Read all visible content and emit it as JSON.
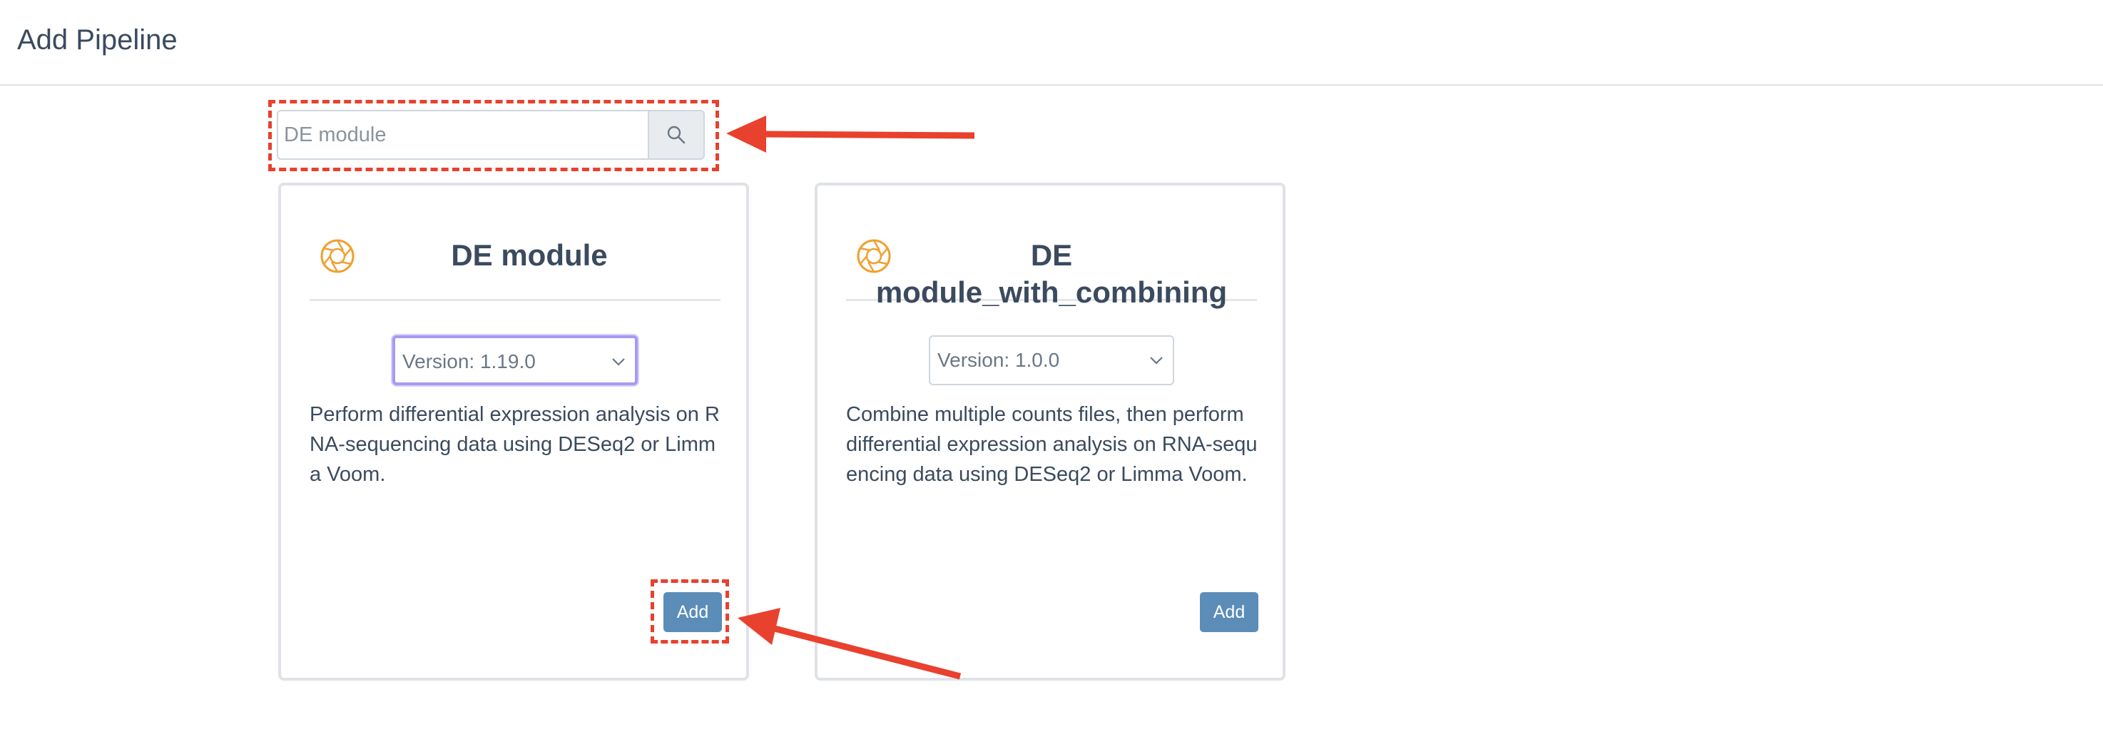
{
  "header": {
    "title": "Add Pipeline"
  },
  "search": {
    "placeholder": "DE module",
    "button_icon": "search-icon"
  },
  "cards": [
    {
      "icon": "aperture-icon",
      "title": "DE module",
      "version": "Version: 1.19.0",
      "description": "Perform differential expression analysis on RNA-sequencing data using DESeq2 or Limma Voom.",
      "add_label": "Add"
    },
    {
      "icon": "aperture-icon",
      "title": "DE module_with_combining",
      "version": "Version: 1.0.0",
      "description": "Combine multiple counts files, then perform differential expression analysis on RNA-sequencing data using DESeq2 or Limma Voom.",
      "add_label": "Add"
    }
  ],
  "colors": {
    "annotation": "#e8412d",
    "add_button": "#5b8db8",
    "icon": "#f0a030",
    "focus_border": "#a89af0"
  }
}
